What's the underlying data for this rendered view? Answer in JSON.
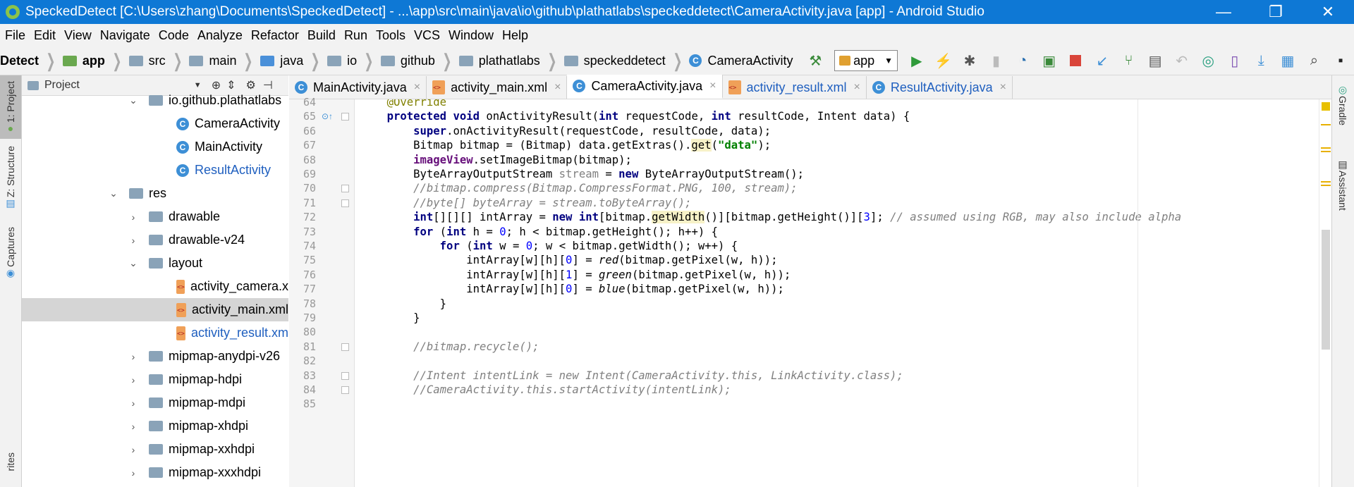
{
  "window": {
    "title": "SpeckedDetect [C:\\Users\\zhang\\Documents\\SpeckedDetect] - ...\\app\\src\\main\\java\\io\\github\\plathatlabs\\speckeddetect\\CameraActivity.java [app] - Android Studio",
    "minimize": "—",
    "restore": "❐",
    "close": "✕"
  },
  "menu": [
    "File",
    "Edit",
    "View",
    "Navigate",
    "Code",
    "Analyze",
    "Refactor",
    "Build",
    "Run",
    "Tools",
    "VCS",
    "Window",
    "Help"
  ],
  "breadcrumbs": [
    "Detect",
    "app",
    "src",
    "main",
    "java",
    "io",
    "github",
    "plathatlabs",
    "speckeddetect",
    "CameraActivity"
  ],
  "toolbar": {
    "run_config": "app"
  },
  "left_strip": {
    "project": "1: Project",
    "structure": "Z: Structure",
    "captures": "Captures",
    "favorites": "rites"
  },
  "project_panel": {
    "header": "Project",
    "tree": [
      {
        "label": "io.github.plathatlabs",
        "type": "package",
        "arrow": "⌄"
      },
      {
        "label": "CameraActivity",
        "type": "class"
      },
      {
        "label": "MainActivity",
        "type": "class"
      },
      {
        "label": "ResultActivity",
        "type": "class",
        "blue": true
      },
      {
        "label": "res",
        "type": "folder",
        "arrow": "⌄"
      },
      {
        "label": "drawable",
        "type": "folder",
        "arrow": "›"
      },
      {
        "label": "drawable-v24",
        "type": "folder",
        "arrow": "›"
      },
      {
        "label": "layout",
        "type": "folder",
        "arrow": "⌄"
      },
      {
        "label": "activity_camera.x",
        "type": "xml"
      },
      {
        "label": "activity_main.xml",
        "type": "xml",
        "selected": true
      },
      {
        "label": "activity_result.xm",
        "type": "xml",
        "blue": true
      },
      {
        "label": "mipmap-anydpi-v26",
        "type": "folder",
        "arrow": "›"
      },
      {
        "label": "mipmap-hdpi",
        "type": "folder",
        "arrow": "›"
      },
      {
        "label": "mipmap-mdpi",
        "type": "folder",
        "arrow": "›"
      },
      {
        "label": "mipmap-xhdpi",
        "type": "folder",
        "arrow": "›"
      },
      {
        "label": "mipmap-xxhdpi",
        "type": "folder",
        "arrow": "›"
      },
      {
        "label": "mipmap-xxxhdpi",
        "type": "folder",
        "arrow": "›"
      }
    ]
  },
  "tabs": [
    {
      "label": "MainActivity.java",
      "type": "class"
    },
    {
      "label": "activity_main.xml",
      "type": "xml"
    },
    {
      "label": "CameraActivity.java",
      "type": "class",
      "active": true
    },
    {
      "label": "activity_result.xml",
      "type": "xml",
      "blue": true
    },
    {
      "label": "ResultActivity.java",
      "type": "class",
      "blue": true
    }
  ],
  "right_strip": {
    "gradle": "Gradle",
    "assistant": "Assistant"
  },
  "code": [
    {
      "n": "64",
      "html": "    <span class=\"ann\">@Override</span>"
    },
    {
      "n": "65",
      "html": "    <span class=\"kw\">protected void</span> onActivityResult(<span class=\"kw\">int</span> requestCode, <span class=\"kw\">int</span> resultCode, Intent data) {"
    },
    {
      "n": "66",
      "html": "        <span class=\"kw\">super</span>.onActivityResult(requestCode, resultCode, data);"
    },
    {
      "n": "67",
      "html": "        Bitmap bitmap = (Bitmap) data.getExtras().<span class=\"hl\">get</span>(<span class=\"str\">\"data\"</span>);"
    },
    {
      "n": "68",
      "html": "        <span class=\"fld\">imageView</span>.setImageBitmap(bitmap);"
    },
    {
      "n": "69",
      "html": "        ByteArrayOutputStream <span class=\"unused\">stream</span> = <span class=\"kw\">new</span> ByteArrayOutputStream();"
    },
    {
      "n": "70",
      "html": "        <span class=\"com\">//bitmap.compress(Bitmap.CompressFormat.PNG, 100, stream);</span>"
    },
    {
      "n": "71",
      "html": "        <span class=\"com\">//byte[] byteArray = stream.toByteArray();</span>"
    },
    {
      "n": "72",
      "html": "        <span class=\"kw\">int</span>[][][] intArray = <span class=\"kw\">new int</span>[bitmap.<span class=\"hl\">getWidth</span>()][bitmap.getHeight()][<span class=\"num\">3</span>]; <span class=\"com\">// assumed using RGB, may also include alpha</span>"
    },
    {
      "n": "73",
      "html": "        <span class=\"kw\">for</span> (<span class=\"kw\">int</span> h = <span class=\"num\">0</span>; h &lt; bitmap.getHeight(); h++) {"
    },
    {
      "n": "74",
      "html": "            <span class=\"kw\">for</span> (<span class=\"kw\">int</span> w = <span class=\"num\">0</span>; w &lt; bitmap.getWidth(); w++) {"
    },
    {
      "n": "75",
      "html": "                intArray[w][h][<span class=\"num\">0</span>] = <span class=\"ital\">red</span>(bitmap.getPixel(w, h));"
    },
    {
      "n": "76",
      "html": "                intArray[w][h][<span class=\"num\">1</span>] = <span class=\"ital\">green</span>(bitmap.getPixel(w, h));"
    },
    {
      "n": "77",
      "html": "                intArray[w][h][<span class=\"num\">0</span>] = <span class=\"ital\">blue</span>(bitmap.getPixel(w, h));"
    },
    {
      "n": "78",
      "html": "            }"
    },
    {
      "n": "79",
      "html": "        }"
    },
    {
      "n": "80",
      "html": ""
    },
    {
      "n": "81",
      "html": "        <span class=\"com\">//bitmap.recycle();</span>"
    },
    {
      "n": "82",
      "html": ""
    },
    {
      "n": "83",
      "html": "        <span class=\"com\">//Intent intentLink = new Intent(CameraActivity.this, LinkActivity.class);</span>"
    },
    {
      "n": "84",
      "html": "        <span class=\"com\">//CameraActivity.this.startActivity(intentLink);</span>"
    },
    {
      "n": "85",
      "html": ""
    }
  ]
}
